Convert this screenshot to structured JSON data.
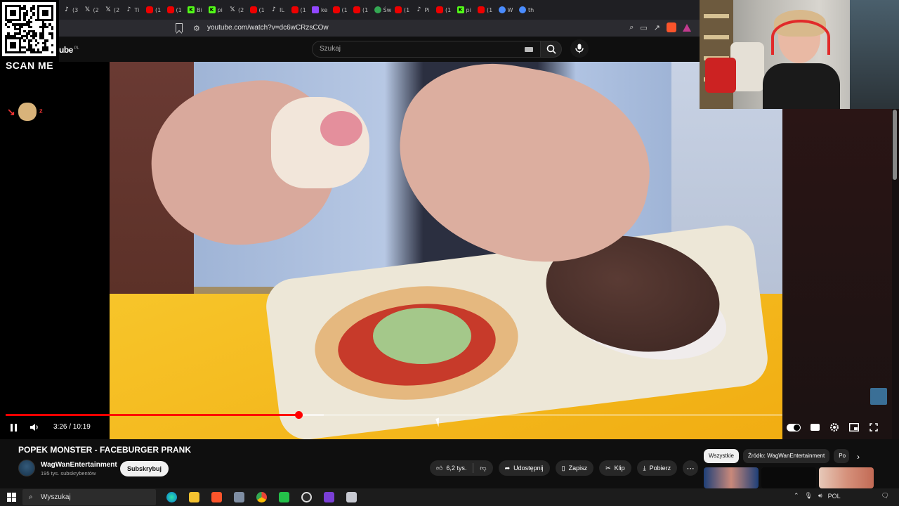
{
  "browser": {
    "tabs": [
      {
        "icon": "tiktok",
        "label": "(3"
      },
      {
        "icon": "x",
        "label": "(2"
      },
      {
        "icon": "x",
        "label": "(2"
      },
      {
        "icon": "tiktok",
        "label": "Ti"
      },
      {
        "icon": "youtube",
        "label": "(1"
      },
      {
        "icon": "youtube",
        "label": "(1"
      },
      {
        "icon": "kick",
        "label": "Bi"
      },
      {
        "icon": "kick",
        "label": "pi"
      },
      {
        "icon": "x",
        "label": "(2"
      },
      {
        "icon": "youtube",
        "label": "(1"
      },
      {
        "icon": "tiktok",
        "label": "IL"
      },
      {
        "icon": "youtube",
        "label": "(1"
      },
      {
        "icon": "twitch",
        "label": "ke"
      },
      {
        "icon": "youtube",
        "label": "(1"
      },
      {
        "icon": "youtube",
        "label": "(1"
      },
      {
        "icon": "maps",
        "label": "Św"
      },
      {
        "icon": "youtube",
        "label": "(1"
      },
      {
        "icon": "tiktok",
        "label": "Pi"
      },
      {
        "icon": "youtube",
        "label": "(1"
      },
      {
        "icon": "kick",
        "label": "pi"
      },
      {
        "icon": "youtube",
        "label": "(1"
      },
      {
        "icon": "misc",
        "label": "W"
      },
      {
        "icon": "misc",
        "label": "th"
      }
    ],
    "url": "youtube.com/watch?v=dc6wCRzsCOw"
  },
  "overlay": {
    "qr_label": "SCAN ME"
  },
  "youtube": {
    "logo": "ube",
    "logo_region": "PL",
    "search_placeholder": "Szukaj"
  },
  "player": {
    "time": "3:26 / 10:19",
    "progress_fraction": 0.377,
    "buffer_fraction": 0.41
  },
  "video": {
    "title": "POPEK MONSTER - FACEBURGER PRANK",
    "channel": "WagWanEntertainment",
    "subscribers": "195 tys. subskrybentów",
    "subscribe_label": "Subskrybuj",
    "actions": {
      "likes": "6,2 tys.",
      "share": "Udostępnij",
      "save": "Zapisz",
      "clip": "Klip",
      "download": "Pobierz"
    }
  },
  "recommendations": {
    "chips": [
      "Wszystkie",
      "Źródło: WagWanEntertainment",
      "Po"
    ]
  },
  "taskbar": {
    "search_placeholder": "Wyszukaj",
    "lang": "POL"
  }
}
